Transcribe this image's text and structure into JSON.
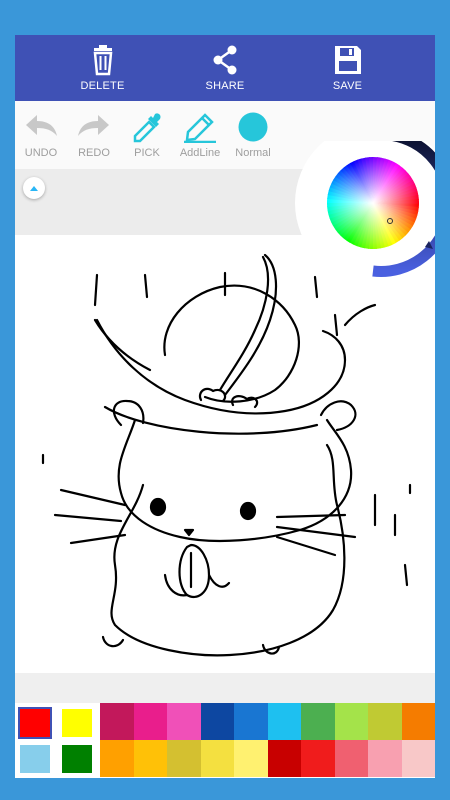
{
  "topbar": {
    "delete_label": "DELETE",
    "share_label": "SHARE",
    "save_label": "SAVE"
  },
  "toolbar": {
    "undo_label": "UNDO",
    "redo_label": "REDO",
    "pick_label": "PICK",
    "addline_label": "AddLine",
    "normal_label": "Normal",
    "accent_color": "#26c6da"
  },
  "palette": {
    "selected": [
      "#ff0000",
      "#ffff00",
      "#87ceeb",
      "#008000"
    ],
    "row1": [
      "#c2185b",
      "#e91e8c",
      "#f050b8",
      "#0d47a1",
      "#1976d2",
      "#1ec0f0",
      "#4caf50",
      "#a4e34a",
      "#c0ca33",
      "#f57c00"
    ],
    "row2": [
      "#ffa000",
      "#ffc107",
      "#d4c030",
      "#f4e040",
      "#fff170",
      "#c80000",
      "#f01c1c",
      "#f06070",
      "#f8a0b0",
      "#f8c8c8"
    ]
  }
}
